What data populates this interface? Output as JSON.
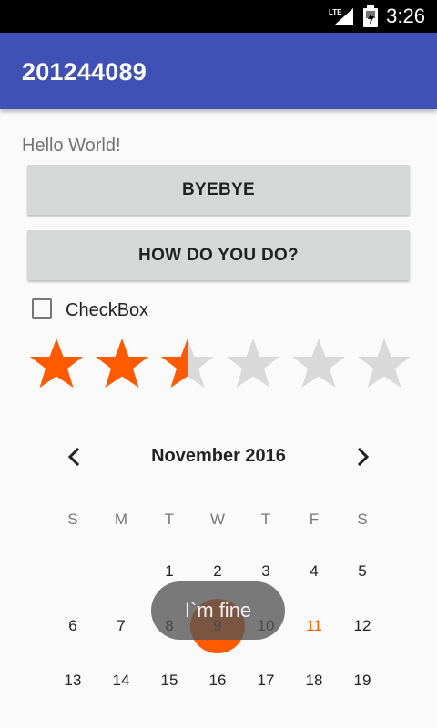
{
  "status_bar": {
    "network_label": "LTE",
    "time": "3:26",
    "icons": [
      "lte-signal-icon",
      "battery-icon"
    ]
  },
  "app_bar": {
    "title": "201244089",
    "color": "#3f51b5"
  },
  "content": {
    "hello_text": "Hello World!",
    "buttons": {
      "byebye": "BYEBYE",
      "how_do_you_do": "HOW DO YOU DO?"
    },
    "checkbox": {
      "label": "CheckBox",
      "checked": false
    },
    "rating": {
      "value": 2.5,
      "max": 6,
      "filled_color": "#ff5a00",
      "empty_color": "#d9d9d9"
    }
  },
  "calendar": {
    "month_label": "November 2016",
    "prev_icon": "chevron-left-icon",
    "next_icon": "chevron-right-icon",
    "weekdays": [
      "S",
      "M",
      "T",
      "W",
      "T",
      "F",
      "S"
    ],
    "days": [
      {
        "label": "1",
        "col": 2,
        "row": 0
      },
      {
        "label": "2",
        "col": 3,
        "row": 0
      },
      {
        "label": "3",
        "col": 4,
        "row": 0
      },
      {
        "label": "4",
        "col": 5,
        "row": 0
      },
      {
        "label": "5",
        "col": 6,
        "row": 0
      },
      {
        "label": "6",
        "col": 0,
        "row": 1
      },
      {
        "label": "7",
        "col": 1,
        "row": 1
      },
      {
        "label": "8",
        "col": 2,
        "row": 1
      },
      {
        "label": "9",
        "col": 3,
        "row": 1,
        "selected": true
      },
      {
        "label": "10",
        "col": 4,
        "row": 1
      },
      {
        "label": "11",
        "col": 5,
        "row": 1,
        "current": true
      },
      {
        "label": "12",
        "col": 6,
        "row": 1
      },
      {
        "label": "13",
        "col": 0,
        "row": 2
      },
      {
        "label": "14",
        "col": 1,
        "row": 2
      },
      {
        "label": "15",
        "col": 2,
        "row": 2
      },
      {
        "label": "16",
        "col": 3,
        "row": 2
      },
      {
        "label": "17",
        "col": 4,
        "row": 2
      },
      {
        "label": "18",
        "col": 5,
        "row": 2
      },
      {
        "label": "19",
        "col": 6,
        "row": 2
      }
    ],
    "accent_color": "#ff5a00"
  },
  "toast": {
    "text": "I`m fine"
  }
}
